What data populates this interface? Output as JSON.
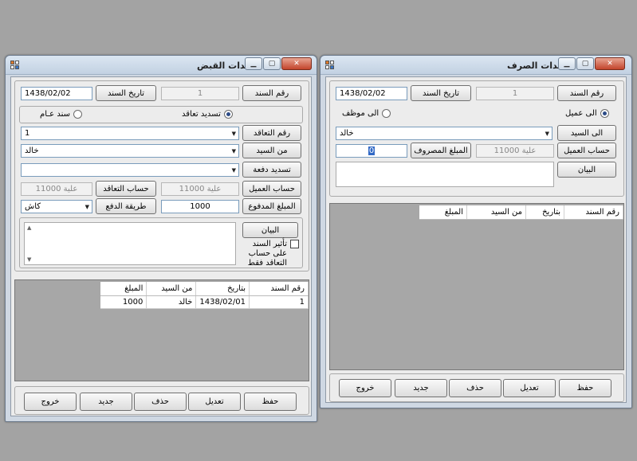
{
  "left": {
    "title": "سندات القبض",
    "voucher_no_label": "رقم السند",
    "voucher_no": "1",
    "date_label": "تاريخ السند",
    "date": "1438/02/02",
    "radio_contract": "تسديد تعاقد",
    "radio_general": "سند عـام",
    "contract_no_label": "رقم التعاقد",
    "contract_no": "1",
    "from_label": "من السيد",
    "from_value": "خالد",
    "installment_label": "تسديد دفعة",
    "installment_value": "",
    "client_account_label": "حساب العميل",
    "client_account": "علية 11000",
    "contract_account_label": "حساب التعاقد",
    "contract_account": "علية 11000",
    "paid_label": "المبلغ المدفوع",
    "paid": "1000",
    "pay_method_label": "طريقة الدفع",
    "pay_method": "كاش",
    "statement_label": "البيان",
    "affect_label": "تأثير السند على حساب التعاقد فقط",
    "grid": {
      "headers": [
        "رقم السند",
        "بتاريخ",
        "من السيد",
        "المبلغ"
      ],
      "rows": [
        [
          "1",
          "1438/02/01",
          "خالد",
          "1000"
        ]
      ]
    },
    "buttons": {
      "save": "حفظ",
      "edit": "تعديل",
      "delete": "حذف",
      "new": "جديد",
      "exit": "خروج"
    }
  },
  "right": {
    "title": "سندات الصرف",
    "voucher_no_label": "رقم السند",
    "voucher_no": "1",
    "date_label": "تاريخ السند",
    "date": "1438/02/02",
    "radio_client": "الى عميل",
    "radio_employee": "الى موظف",
    "to_label": "الى السيد",
    "to_value": "خالد",
    "client_account_label": "حساب العميل",
    "client_account": "علية 11000",
    "spent_label": "المبلغ المصروف",
    "spent": "0",
    "statement_label": "البيان",
    "grid": {
      "headers": [
        "رقم السند",
        "بتاريخ",
        "من السيد",
        "المبلغ"
      ],
      "rows": []
    },
    "buttons": {
      "save": "حفظ",
      "edit": "تعديل",
      "delete": "حذف",
      "new": "جديد",
      "exit": "خروج"
    }
  }
}
